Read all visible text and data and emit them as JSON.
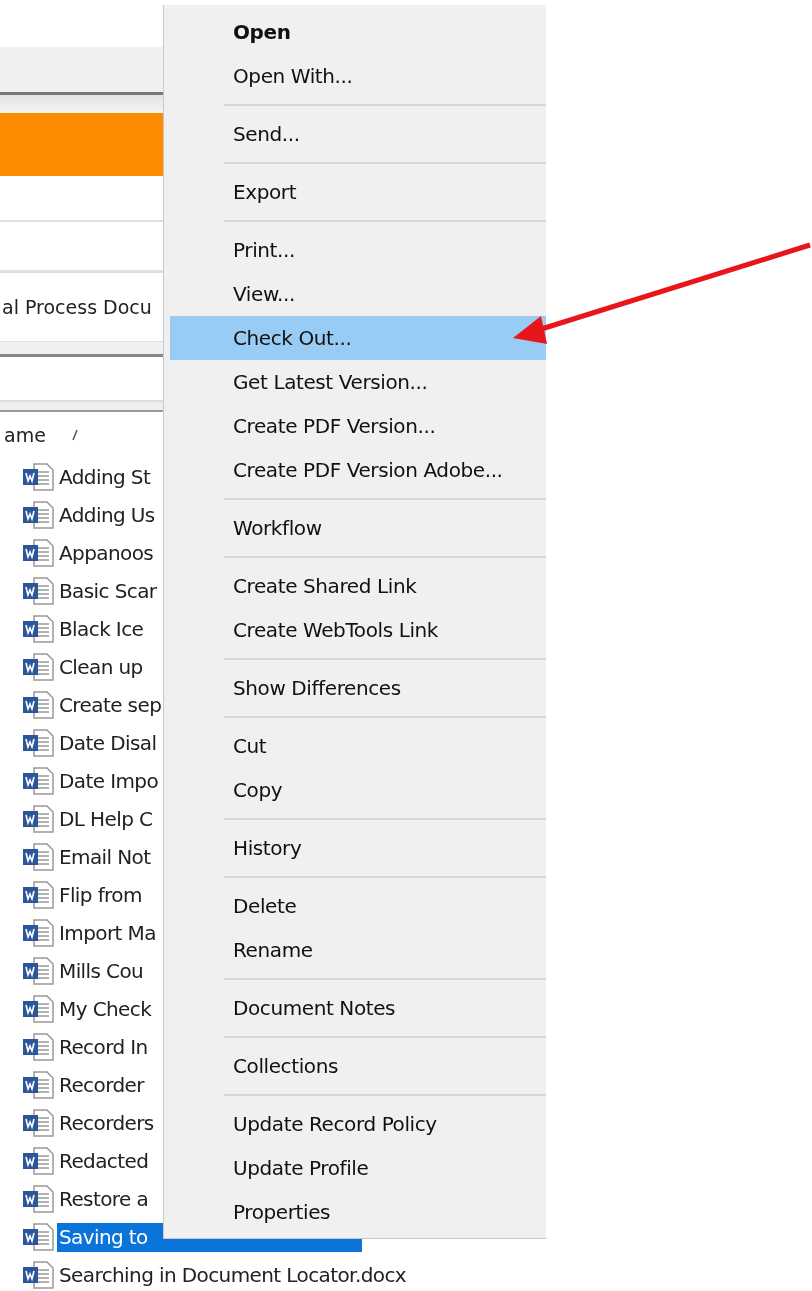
{
  "background": {
    "path_field": {
      "value": "al Process Docu"
    },
    "column_header": {
      "label": "ame"
    },
    "files": [
      {
        "name": "Adding St",
        "selected": false
      },
      {
        "name": "Adding Us",
        "selected": false
      },
      {
        "name": "Appanoos",
        "selected": false
      },
      {
        "name": "Basic Scar",
        "selected": false
      },
      {
        "name": "Black Ice",
        "selected": false
      },
      {
        "name": "Clean up",
        "selected": false
      },
      {
        "name": "Create sep",
        "selected": false
      },
      {
        "name": "Date Disal",
        "selected": false
      },
      {
        "name": "Date Impo",
        "selected": false
      },
      {
        "name": "DL Help C",
        "selected": false
      },
      {
        "name": "Email Not",
        "selected": false
      },
      {
        "name": "Flip from",
        "selected": false
      },
      {
        "name": "Import Ma",
        "selected": false
      },
      {
        "name": "Mills Cou",
        "selected": false
      },
      {
        "name": "My Check",
        "selected": false
      },
      {
        "name": "Record In",
        "selected": false
      },
      {
        "name": "Recorder",
        "selected": false
      },
      {
        "name": "Recorders",
        "selected": false
      },
      {
        "name": "Redacted",
        "selected": false
      },
      {
        "name": "Restore a",
        "selected": false
      },
      {
        "name": "Saving to",
        "selected": true
      },
      {
        "name": "Searching in Document Locator.docx",
        "selected": false
      }
    ]
  },
  "context_menu": {
    "groups": [
      [
        {
          "label": "Open",
          "default": true,
          "selected": false
        },
        {
          "label": "Open With...",
          "default": false,
          "selected": false
        }
      ],
      [
        {
          "label": "Send...",
          "default": false,
          "selected": false
        }
      ],
      [
        {
          "label": "Export",
          "default": false,
          "selected": false
        }
      ],
      [
        {
          "label": "Print...",
          "default": false,
          "selected": false
        },
        {
          "label": "View...",
          "default": false,
          "selected": false
        },
        {
          "label": "Check Out...",
          "default": false,
          "selected": true
        },
        {
          "label": "Get Latest Version...",
          "default": false,
          "selected": false
        },
        {
          "label": "Create PDF Version...",
          "default": false,
          "selected": false
        },
        {
          "label": "Create PDF Version Adobe...",
          "default": false,
          "selected": false
        }
      ],
      [
        {
          "label": "Workflow",
          "default": false,
          "selected": false
        }
      ],
      [
        {
          "label": "Create Shared Link",
          "default": false,
          "selected": false
        },
        {
          "label": "Create WebTools Link",
          "default": false,
          "selected": false
        }
      ],
      [
        {
          "label": "Show Differences",
          "default": false,
          "selected": false
        }
      ],
      [
        {
          "label": "Cut",
          "default": false,
          "selected": false
        },
        {
          "label": "Copy",
          "default": false,
          "selected": false
        }
      ],
      [
        {
          "label": "History",
          "default": false,
          "selected": false
        }
      ],
      [
        {
          "label": "Delete",
          "default": false,
          "selected": false
        },
        {
          "label": "Rename",
          "default": false,
          "selected": false
        }
      ],
      [
        {
          "label": "Document Notes",
          "default": false,
          "selected": false
        }
      ],
      [
        {
          "label": "Collections",
          "default": false,
          "selected": false
        }
      ],
      [
        {
          "label": "Update Record Policy",
          "default": false,
          "selected": false
        },
        {
          "label": "Update Profile",
          "default": false,
          "selected": false
        },
        {
          "label": "Properties",
          "default": false,
          "selected": false
        }
      ]
    ]
  },
  "annotation": {
    "kind": "arrow"
  }
}
